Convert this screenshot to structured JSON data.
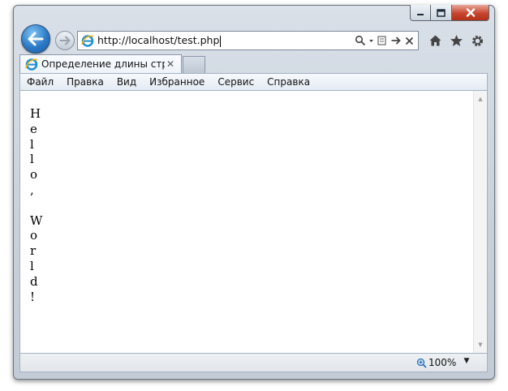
{
  "browser": {
    "address": {
      "url": "http://localhost/test.php"
    },
    "tab": {
      "title": "Определение длины строки"
    },
    "menu": [
      "Файл",
      "Правка",
      "Вид",
      "Избранное",
      "Сервис",
      "Справка"
    ],
    "status": {
      "zoom": "100%"
    },
    "icons": {
      "back": "back-arrow-icon",
      "forward": "forward-arrow-icon",
      "search": "search-icon",
      "compat": "compatibility-view-icon",
      "refresh": "refresh-icon",
      "stop": "stop-icon",
      "home": "home-icon",
      "favorites": "star-icon",
      "tools": "gear-icon"
    },
    "colors": {
      "back_button": "#2c7ac8",
      "close_button": "#c7452e"
    }
  },
  "page": {
    "characters": [
      "H",
      "e",
      "l",
      "l",
      "o",
      ",",
      "",
      "W",
      "o",
      "r",
      "l",
      "d",
      "!"
    ]
  }
}
